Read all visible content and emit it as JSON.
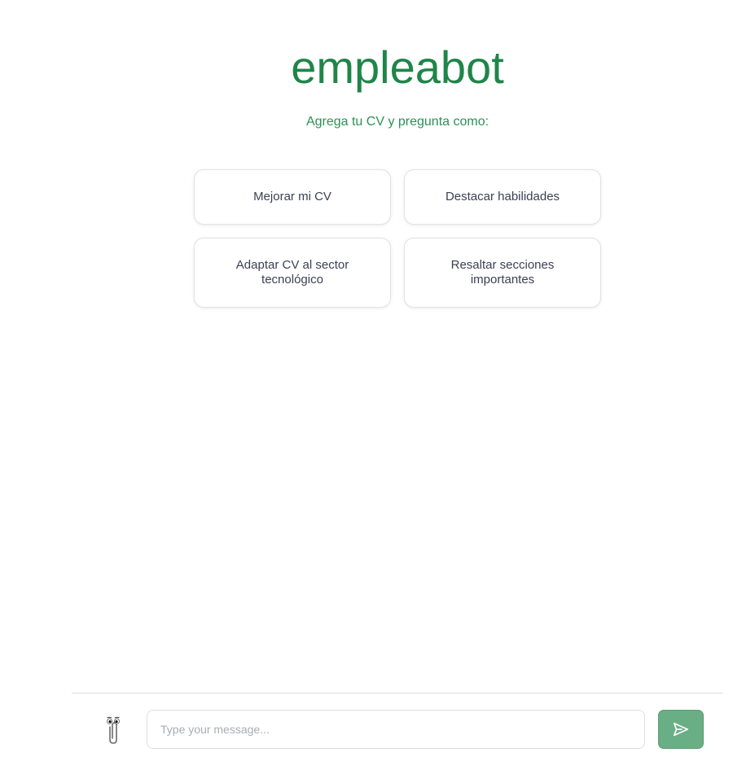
{
  "header": {
    "title": "empleabot",
    "subtitle": "Agrega tu CV y pregunta como:"
  },
  "suggestions": [
    {
      "label": "Mejorar mi CV"
    },
    {
      "label": "Destacar habilidades"
    },
    {
      "label": "Adaptar CV al sector tecnológico"
    },
    {
      "label": "Resaltar secciones importantes"
    }
  ],
  "composer": {
    "placeholder": "Type your message...",
    "attach_icon": "paperclip-icon",
    "send_icon": "send-icon"
  },
  "colors": {
    "brand": "#1f8549",
    "send_button": "#6aae86"
  }
}
